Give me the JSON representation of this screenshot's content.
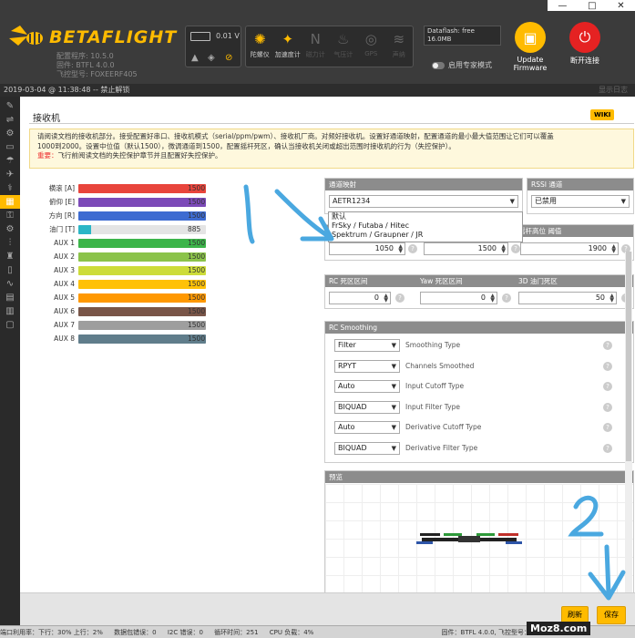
{
  "window": {
    "minimize": "—",
    "maximize": "□",
    "close": "✕"
  },
  "app": {
    "brand": "BETAFLIGHT",
    "config_version": "配置程序: 10.5.0",
    "firmware": "固件: BTFL 4.0.0",
    "target": "飞控型号: FOXEERF405"
  },
  "battery": {
    "voltage": "0.01 V"
  },
  "sensors": [
    {
      "label": "陀螺仪",
      "icon": "gyro-icon",
      "active": true
    },
    {
      "label": "加速度计",
      "icon": "accel-icon",
      "active": true
    },
    {
      "label": "磁力计",
      "icon": "mag-icon",
      "active": false
    },
    {
      "label": "气压计",
      "icon": "baro-icon",
      "active": false
    },
    {
      "label": "GPS",
      "icon": "gps-icon",
      "active": false
    },
    {
      "label": "声纳",
      "icon": "sonar-icon",
      "active": false
    }
  ],
  "dataflash": {
    "label": "Dataflash: free",
    "value": "16.0MB"
  },
  "expert_mode": "启用专家模式",
  "update_firmware": "Update Firmware",
  "disconnect": "断开连接",
  "status": {
    "timestamp": "2019-03-04 @ 11:38:48 -- 禁止解锁",
    "show_log": "显示日志"
  },
  "page": {
    "title": "接收机",
    "wiki": "WIKI",
    "note_line1": "请阅读文档的接收机部分。接受配置好串口、接收机模式（serial/ppm/pwm）、接收机厂商。对频好接收机。设置好通道映射，配置通道的最小最大值范围让它们可以覆盖",
    "note_line2": "1000到2000。设置中位值（默认1500），微调通道到1500，配置摇杆死区，确认当接收机关闭或超出范围时接收机的行为（失控保护）。",
    "note_warn_label": "重要：",
    "note_warn": "飞行前阅读文档的失控保护章节并且配置好失控保护。"
  },
  "channels": [
    {
      "name": "横滚 [A]",
      "value": "1500",
      "fraction": 1.0,
      "color": "#e8453c"
    },
    {
      "name": "俯仰 [E]",
      "value": "1500",
      "fraction": 1.0,
      "color": "#7c4ab8"
    },
    {
      "name": "方向 [R]",
      "value": "1500",
      "fraction": 1.0,
      "color": "#3d6bd1"
    },
    {
      "name": "油门 [T]",
      "value": "885",
      "fraction": 0.1,
      "color": "#2bb6c6"
    },
    {
      "name": "AUX 1",
      "value": "1500",
      "fraction": 1.0,
      "color": "#3cb54a"
    },
    {
      "name": "AUX 2",
      "value": "1500",
      "fraction": 1.0,
      "color": "#8bc34a"
    },
    {
      "name": "AUX 3",
      "value": "1500",
      "fraction": 1.0,
      "color": "#cddc39"
    },
    {
      "name": "AUX 4",
      "value": "1500",
      "fraction": 1.0,
      "color": "#ffc107"
    },
    {
      "name": "AUX 5",
      "value": "1500",
      "fraction": 1.0,
      "color": "#ff9800"
    },
    {
      "name": "AUX 6",
      "value": "1500",
      "fraction": 1.0,
      "color": "#795548"
    },
    {
      "name": "AUX 7",
      "value": "1500",
      "fraction": 1.0,
      "color": "#9e9e9e"
    },
    {
      "name": "AUX 8",
      "value": "1500",
      "fraction": 1.0,
      "color": "#607d8b"
    }
  ],
  "mapping": {
    "header": "通道映射",
    "value": "AETR1234",
    "options": [
      "默认",
      "FrSky / Futaba / Hitec",
      "Spektrum / Graupner / JR"
    ]
  },
  "rssi": {
    "header": "RSSI 通道",
    "value": "已禁用"
  },
  "stick": {
    "header": "摇杆高位 阈值",
    "low": "1050",
    "center": "1500",
    "high": "1900"
  },
  "deadband": {
    "rc_header": "RC 死区区间",
    "rc_value": "0",
    "yaw_header": "Yaw 死区区间",
    "yaw_value": "0",
    "throttle_header": "3D 油门死区",
    "throttle_value": "50"
  },
  "smoothing": {
    "header": "RC Smoothing",
    "rows": [
      {
        "value": "Filter",
        "label": "Smoothing Type"
      },
      {
        "value": "RPYT",
        "label": "Channels Smoothed"
      },
      {
        "value": "Auto",
        "label": "Input Cutoff Type"
      },
      {
        "value": "BIQUAD",
        "label": "Input Filter Type"
      },
      {
        "value": "Auto",
        "label": "Derivative Cutoff Type"
      },
      {
        "value": "BIQUAD",
        "label": "Derivative Filter Type"
      }
    ]
  },
  "preview": {
    "header": "预览"
  },
  "buttons": {
    "refresh": "刷新",
    "save": "保存"
  },
  "footer": {
    "port": "端口利用率：下行：30% 上行：2%",
    "packet_errors": "数据包错误：0",
    "i2c_errors": "I2C 错误：0",
    "cycle": "循环时间：251",
    "cpu": "CPU 负载：4%",
    "firmware": "固件：BTFL 4.0.0, 飞控型号：FOXEERF405"
  },
  "watermark": "Moz8.com",
  "annotations": {
    "step1": "1",
    "step2": "2"
  }
}
